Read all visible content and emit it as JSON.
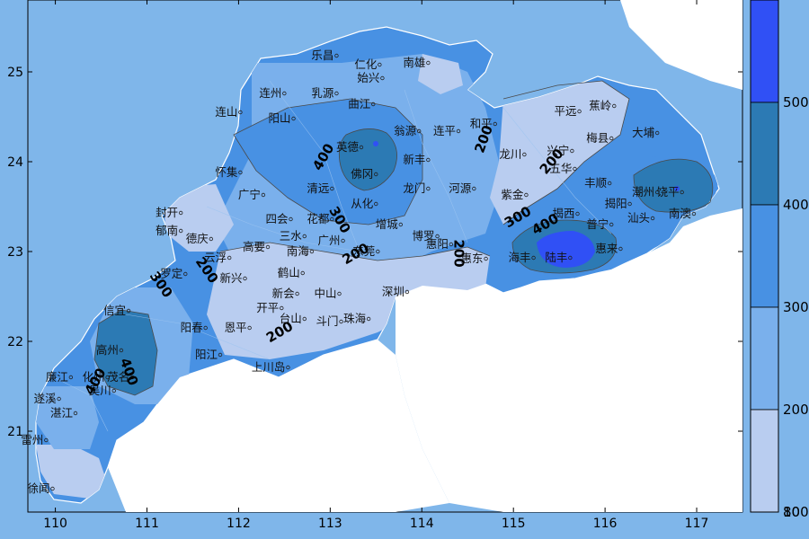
{
  "map": {
    "x_ticks": [
      "110",
      "111",
      "112",
      "113",
      "114",
      "115",
      "116",
      "117"
    ],
    "y_ticks": [
      "25",
      "24",
      "23",
      "22",
      "21"
    ],
    "x_range": [
      109.7,
      117.5
    ],
    "y_range": [
      20.1,
      25.8
    ],
    "colorbar": {
      "levels": [
        "500",
        "400",
        "300",
        "200",
        "100",
        "80"
      ],
      "colors": [
        "#3050f5",
        "#2c7ab4",
        "#4891e3",
        "#7ab0ec",
        "#b9cdf0"
      ]
    },
    "colors": {
      "background": "#7fb6ea",
      "sea": "#ffffff",
      "low": "#b9cdf0",
      "mid": "#7ab0ec",
      "high": "#4891e3",
      "very_high": "#2c7ab4",
      "peak": "#3050f5"
    },
    "contour_labels": [
      {
        "text": "400",
        "lon": 112.93,
        "lat": 24.05,
        "rot": -60
      },
      {
        "text": "300",
        "lon": 113.1,
        "lat": 23.35,
        "rot": 60
      },
      {
        "text": "200",
        "lon": 113.28,
        "lat": 22.97,
        "rot": -30
      },
      {
        "text": "200",
        "lon": 114.68,
        "lat": 24.25,
        "rot": -70
      },
      {
        "text": "200",
        "lon": 114.4,
        "lat": 22.98,
        "rot": 90
      },
      {
        "text": "200",
        "lon": 115.42,
        "lat": 24.0,
        "rot": -50
      },
      {
        "text": "300",
        "lon": 115.05,
        "lat": 23.38,
        "rot": -30
      },
      {
        "text": "400",
        "lon": 115.35,
        "lat": 23.3,
        "rot": -30
      },
      {
        "text": "300",
        "lon": 111.15,
        "lat": 22.63,
        "rot": 55
      },
      {
        "text": "200",
        "lon": 111.65,
        "lat": 22.79,
        "rot": 55
      },
      {
        "text": "200",
        "lon": 112.45,
        "lat": 22.1,
        "rot": -30
      },
      {
        "text": "400",
        "lon": 110.8,
        "lat": 21.66,
        "rot": 70
      },
      {
        "text": "400",
        "lon": 110.44,
        "lat": 21.55,
        "rot": -60
      }
    ],
    "cities": [
      {
        "name": "乐昌",
        "lon": 113.05,
        "lat": 25.18
      },
      {
        "name": "仁化",
        "lon": 113.52,
        "lat": 25.08
      },
      {
        "name": "南雄",
        "lon": 114.05,
        "lat": 25.1
      },
      {
        "name": "始兴",
        "lon": 113.55,
        "lat": 24.93
      },
      {
        "name": "连州",
        "lon": 112.48,
        "lat": 24.76
      },
      {
        "name": "乳源",
        "lon": 113.05,
        "lat": 24.76
      },
      {
        "name": "连山",
        "lon": 112.0,
        "lat": 24.55
      },
      {
        "name": "阳山",
        "lon": 112.58,
        "lat": 24.48
      },
      {
        "name": "曲江",
        "lon": 113.45,
        "lat": 24.64
      },
      {
        "name": "翁源",
        "lon": 113.95,
        "lat": 24.34
      },
      {
        "name": "连平",
        "lon": 114.38,
        "lat": 24.34
      },
      {
        "name": "和平",
        "lon": 114.78,
        "lat": 24.42
      },
      {
        "name": "平远",
        "lon": 115.7,
        "lat": 24.56
      },
      {
        "name": "蕉岭",
        "lon": 116.08,
        "lat": 24.62
      },
      {
        "name": "英德",
        "lon": 113.32,
        "lat": 24.16
      },
      {
        "name": "新丰",
        "lon": 114.05,
        "lat": 24.02
      },
      {
        "name": "龙川",
        "lon": 115.1,
        "lat": 24.08
      },
      {
        "name": "兴宁",
        "lon": 115.62,
        "lat": 24.12
      },
      {
        "name": "梅县",
        "lon": 116.05,
        "lat": 24.26
      },
      {
        "name": "大埔",
        "lon": 116.55,
        "lat": 24.32
      },
      {
        "name": "怀集",
        "lon": 112.0,
        "lat": 23.88
      },
      {
        "name": "佛冈",
        "lon": 113.48,
        "lat": 23.86
      },
      {
        "name": "五华",
        "lon": 115.65,
        "lat": 23.92
      },
      {
        "name": "丰顺",
        "lon": 116.03,
        "lat": 23.76
      },
      {
        "name": "清远",
        "lon": 113.0,
        "lat": 23.7
      },
      {
        "name": "龙门",
        "lon": 114.05,
        "lat": 23.7
      },
      {
        "name": "河源",
        "lon": 114.55,
        "lat": 23.7
      },
      {
        "name": "紫金",
        "lon": 115.12,
        "lat": 23.63
      },
      {
        "name": "潮州",
        "lon": 116.55,
        "lat": 23.66
      },
      {
        "name": "饶平",
        "lon": 116.82,
        "lat": 23.66
      },
      {
        "name": "广宁",
        "lon": 112.25,
        "lat": 23.63
      },
      {
        "name": "从化",
        "lon": 113.48,
        "lat": 23.53
      },
      {
        "name": "揭阳",
        "lon": 116.25,
        "lat": 23.53
      },
      {
        "name": "封开",
        "lon": 111.35,
        "lat": 23.43
      },
      {
        "name": "四会",
        "lon": 112.55,
        "lat": 23.36
      },
      {
        "name": "花都",
        "lon": 113.0,
        "lat": 23.36
      },
      {
        "name": "增城",
        "lon": 113.75,
        "lat": 23.3
      },
      {
        "name": "揭西",
        "lon": 115.68,
        "lat": 23.42
      },
      {
        "name": "普宁",
        "lon": 116.05,
        "lat": 23.3
      },
      {
        "name": "汕头",
        "lon": 116.5,
        "lat": 23.37
      },
      {
        "name": "南澳",
        "lon": 116.95,
        "lat": 23.42
      },
      {
        "name": "郁南",
        "lon": 111.35,
        "lat": 23.23
      },
      {
        "name": "德庆",
        "lon": 111.68,
        "lat": 23.14
      },
      {
        "name": "高要",
        "lon": 112.3,
        "lat": 23.05
      },
      {
        "name": "三水",
        "lon": 112.7,
        "lat": 23.17
      },
      {
        "name": "广州",
        "lon": 113.12,
        "lat": 23.12
      },
      {
        "name": "博罗",
        "lon": 114.15,
        "lat": 23.17
      },
      {
        "name": "云浮",
        "lon": 111.88,
        "lat": 22.93
      },
      {
        "name": "南海",
        "lon": 112.78,
        "lat": 23.0
      },
      {
        "name": "东莞",
        "lon": 113.5,
        "lat": 23.0
      },
      {
        "name": "惠阳",
        "lon": 114.3,
        "lat": 23.08
      },
      {
        "name": "惠东",
        "lon": 114.68,
        "lat": 22.92
      },
      {
        "name": "海丰",
        "lon": 115.2,
        "lat": 22.93
      },
      {
        "name": "陆丰",
        "lon": 115.6,
        "lat": 22.93
      },
      {
        "name": "惠来",
        "lon": 116.15,
        "lat": 23.03
      },
      {
        "name": "罗定",
        "lon": 111.4,
        "lat": 22.75
      },
      {
        "name": "新兴",
        "lon": 112.05,
        "lat": 22.7
      },
      {
        "name": "鹤山",
        "lon": 112.68,
        "lat": 22.76
      },
      {
        "name": "新会",
        "lon": 112.62,
        "lat": 22.53
      },
      {
        "name": "中山",
        "lon": 113.08,
        "lat": 22.53
      },
      {
        "name": "深圳",
        "lon": 113.82,
        "lat": 22.55
      },
      {
        "name": "信宜",
        "lon": 110.78,
        "lat": 22.34
      },
      {
        "name": "开平",
        "lon": 112.45,
        "lat": 22.37
      },
      {
        "name": "台山",
        "lon": 112.7,
        "lat": 22.25
      },
      {
        "name": "斗门",
        "lon": 113.1,
        "lat": 22.22
      },
      {
        "name": "珠海",
        "lon": 113.4,
        "lat": 22.25
      },
      {
        "name": "阳春",
        "lon": 111.62,
        "lat": 22.15
      },
      {
        "name": "恩平",
        "lon": 112.1,
        "lat": 22.15
      },
      {
        "name": "高州",
        "lon": 110.7,
        "lat": 21.9
      },
      {
        "name": "阳江",
        "lon": 111.78,
        "lat": 21.85
      },
      {
        "name": "上川岛",
        "lon": 112.52,
        "lat": 21.71
      },
      {
        "name": "廉江",
        "lon": 110.15,
        "lat": 21.6
      },
      {
        "name": "化州",
        "lon": 110.55,
        "lat": 21.6
      },
      {
        "name": "茂名",
        "lon": 110.82,
        "lat": 21.6
      },
      {
        "name": "吴川",
        "lon": 110.62,
        "lat": 21.45
      },
      {
        "name": "遂溪",
        "lon": 110.02,
        "lat": 21.36
      },
      {
        "name": "湛江",
        "lon": 110.2,
        "lat": 21.2
      },
      {
        "name": "雷州",
        "lon": 109.88,
        "lat": 20.9
      },
      {
        "name": "徐闻",
        "lon": 109.95,
        "lat": 20.36
      }
    ]
  }
}
